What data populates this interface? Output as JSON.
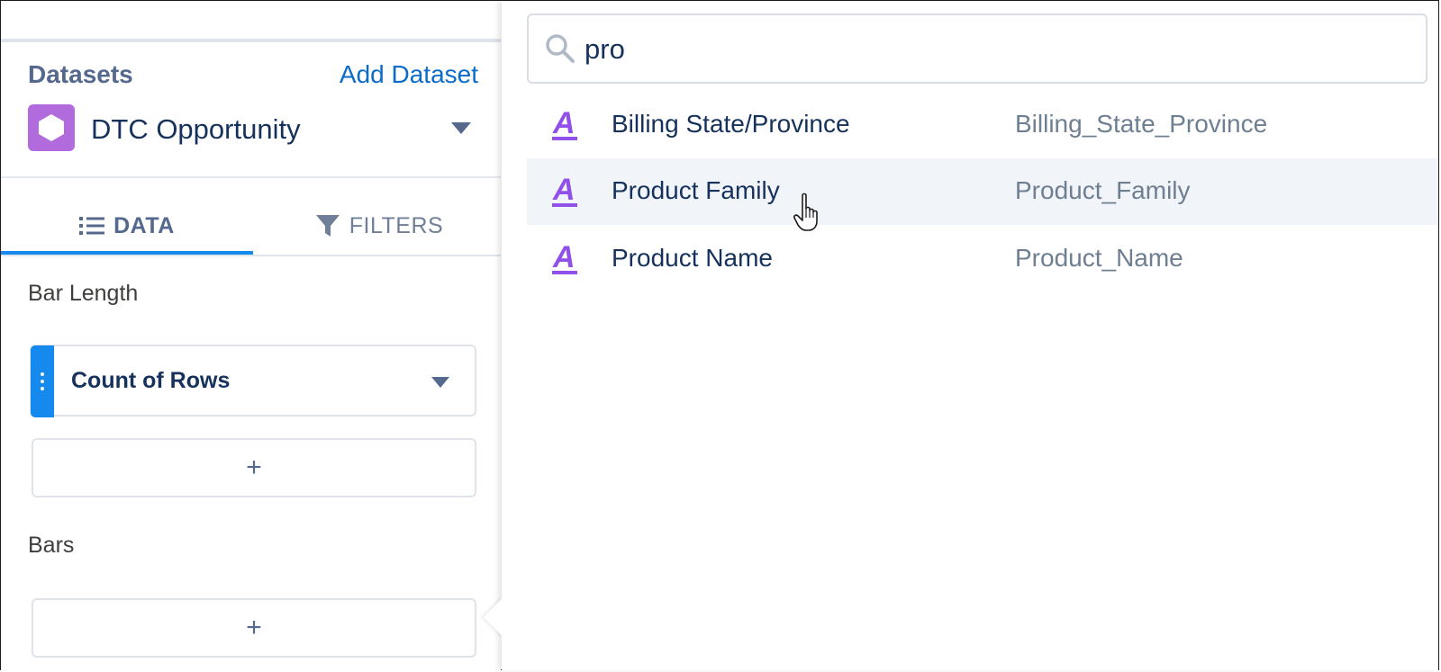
{
  "datasets": {
    "title": "Datasets",
    "add_label": "Add Dataset",
    "selected": "DTC Opportunity",
    "badge_color": "#b16bdc"
  },
  "tabs": [
    {
      "label": "DATA",
      "icon": "list-icon",
      "active": true
    },
    {
      "label": "FILTERS",
      "icon": "filter-icon",
      "active": false
    }
  ],
  "sections": {
    "bar_length": {
      "label": "Bar Length",
      "measure": "Count of Rows",
      "add_label": "+"
    },
    "bars": {
      "label": "Bars",
      "add_label": "+"
    }
  },
  "search": {
    "value": "pro",
    "icon": "search-icon"
  },
  "results": [
    {
      "label": "Billing State/Province",
      "api_name": "Billing_State_Province",
      "type_icon": "text-field-icon",
      "hovered": false
    },
    {
      "label": "Product Family",
      "api_name": "Product_Family",
      "type_icon": "text-field-icon",
      "hovered": true
    },
    {
      "label": "Product Name",
      "api_name": "Product_Name",
      "type_icon": "text-field-icon",
      "hovered": false
    }
  ],
  "colors": {
    "accent": "#1589ee",
    "link": "#0b6bcb",
    "text_dark": "#16325c",
    "dimension_icon": "#9050e9",
    "hover_row": "#f1f4f9"
  }
}
